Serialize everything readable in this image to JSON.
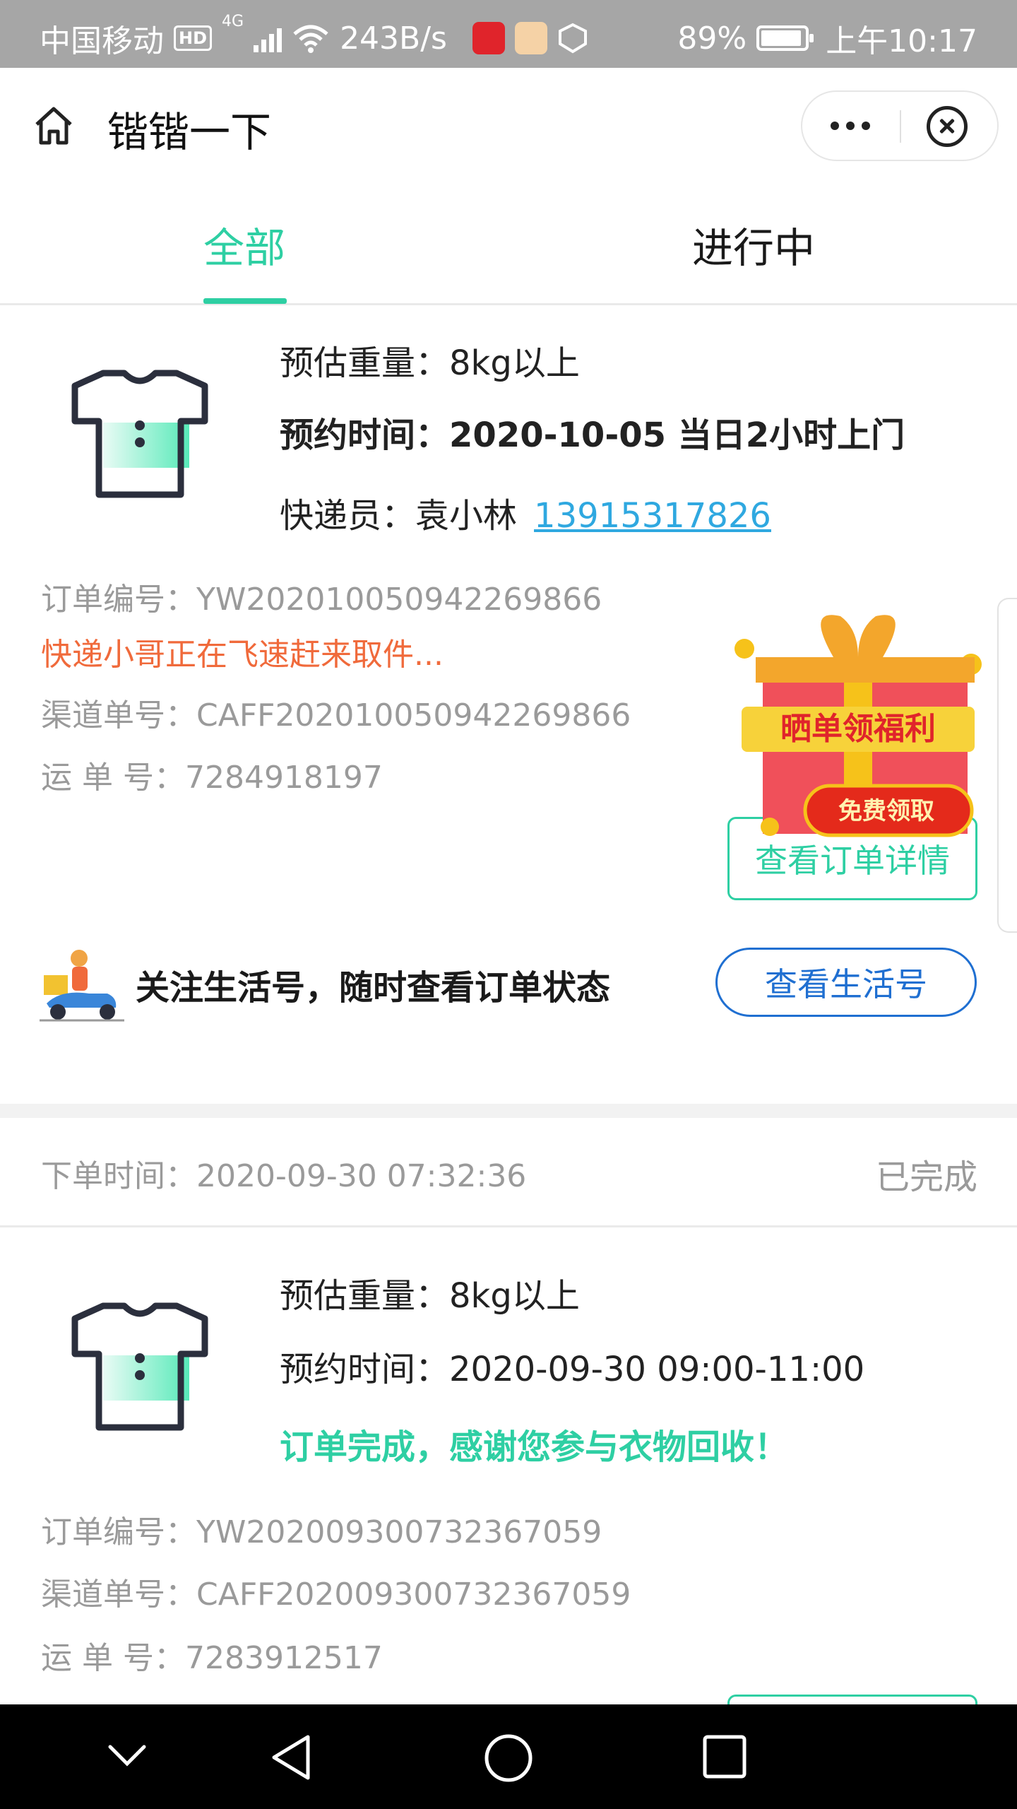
{
  "status_bar": {
    "carrier": "中国移动",
    "hd": "HD",
    "network": "4G",
    "speed": "243B/s",
    "battery": "89%",
    "time": "上午10:17"
  },
  "navbar": {
    "title": "锴锴一下"
  },
  "tabs": [
    {
      "label": "全部",
      "active": true
    },
    {
      "label": "进行中",
      "active": false
    }
  ],
  "orders": [
    {
      "weight_label": "预估重量：",
      "weight_value": "8kg以上",
      "time_label": "预约时间：",
      "time_value": "2020-10-05 当日2小时上门",
      "courier_label": "快递员：",
      "courier_name": "袁小林",
      "courier_phone": "13915317826",
      "order_no": "订单编号：YW202010050942269866",
      "progress_msg": "快递小哥正在飞速赶来取件...",
      "channel_no": "渠道单号：CAFF202010050942269866",
      "waybill_no": "运  单  号：7284918197",
      "detail_button": "查看订单详情"
    },
    {
      "placed_time": "下单时间：2020-09-30 07:32:36",
      "status": "已完成",
      "weight_label": "预估重量：",
      "weight_value": "8kg以上",
      "time_label": "预约时间：",
      "time_value": "2020-09-30 09:00-11:00",
      "complete_msg": "订单完成，感谢您参与衣物回收！",
      "order_no": "订单编号：YW202009300732367059",
      "channel_no": "渠道单号：CAFF202009300732367059",
      "waybill_no": "运  单  号：7283912517"
    }
  ],
  "follow": {
    "text": "关注生活号，随时查看订单状态",
    "button": "查看生活号"
  },
  "gift": {
    "title": "晒单领福利",
    "cta": "免费领取"
  },
  "colors": {
    "accent_green": "#2ecfa3",
    "link_blue": "#2fa8e0",
    "button_blue": "#1f6fd1",
    "progress_orange": "#f06a3b",
    "status_bar_grey": "#a6a6a6"
  },
  "icons": [
    "home-icon",
    "more-icon",
    "close-icon",
    "shirt-icon",
    "courier-scooter-icon",
    "gift-icon",
    "back-icon",
    "home-circle-icon",
    "recent-apps-icon",
    "chevron-down-icon"
  ]
}
